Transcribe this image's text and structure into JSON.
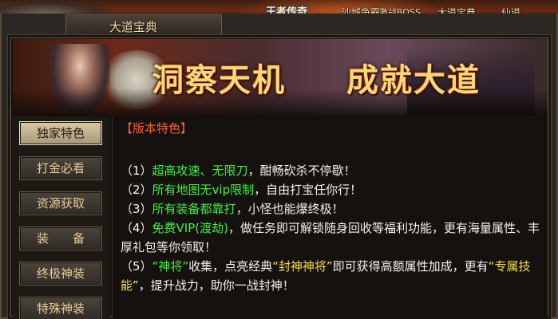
{
  "topbar": {
    "logo": "王者传奇",
    "nav": [
      "沙城争霸",
      "激战BOSS",
      "大道宝典",
      "仙道"
    ]
  },
  "window": {
    "title": "大道宝典"
  },
  "banner": {
    "slogan_left": "洞察天机",
    "slogan_right": "成就大道"
  },
  "sidebar": {
    "items": [
      {
        "label": "独家特色",
        "active": true
      },
      {
        "label": "打金必看",
        "active": false
      },
      {
        "label": "资源获取",
        "active": false
      },
      {
        "label": "装　　备",
        "active": false
      },
      {
        "label": "终极神装",
        "active": false
      },
      {
        "label": "特殊神装",
        "active": false
      }
    ]
  },
  "content": {
    "section_title": "【版本特色】",
    "lines": [
      {
        "prefix": "（1）",
        "highlight": "超高攻速、无限刀",
        "rest": "，酣畅砍杀不停歇！"
      },
      {
        "prefix": "（2）",
        "highlight": "所有地图无vip限制",
        "rest": "，自由打宝任你行！"
      },
      {
        "prefix": "（3）",
        "highlight": "所有装备都靠打",
        "rest": "，小怪也能爆终极！"
      },
      {
        "prefix": "（4）",
        "highlight": "免费VIP(渡劫)",
        "rest": "，做任务即可解锁随身回收等福利功能，更有海量属性、丰厚礼包等你领取！"
      },
      {
        "prefix": "（5）",
        "q1": "“神将”",
        "mid1": "收集，点亮经典",
        "q2": "“封神神将”",
        "mid2": "即可获得高额属性加成，更有",
        "q3": "“专属技能”",
        "rest": "，提升战力，助你一战封神！"
      }
    ]
  },
  "colors": {
    "title_red": "#ff5a3c",
    "highlight_green": "#3ef23e",
    "highlight_yellow": "#f4e046",
    "gold_text": "#e6cc98"
  }
}
